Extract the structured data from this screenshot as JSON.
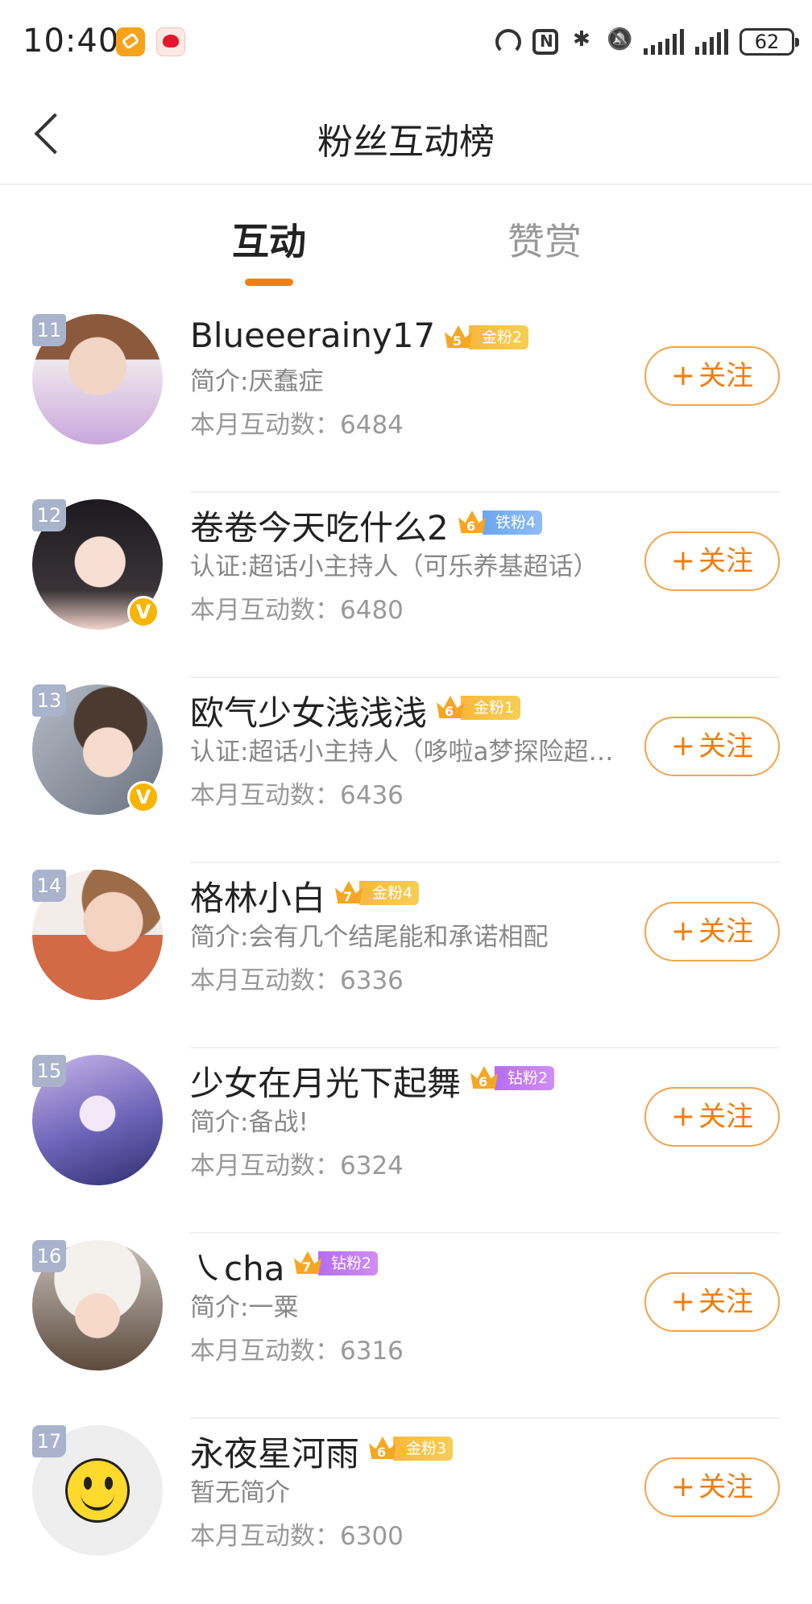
{
  "status_bar": {
    "time": "10:40",
    "battery": "62"
  },
  "header": {
    "title": "粉丝互动榜"
  },
  "tabs": [
    {
      "label": "互动",
      "active": true
    },
    {
      "label": "赞赏",
      "active": false
    }
  ],
  "follow_label": "关注",
  "count_prefix": "本月互动数：",
  "fans": [
    {
      "rank": "11",
      "name": "Blueeerainy17",
      "crown_level": "5",
      "fan_badge": "金粉2",
      "badge_type": "gold",
      "verified": false,
      "desc": "简介:厌蠢症",
      "count": "6484"
    },
    {
      "rank": "12",
      "name": "卷卷今天吃什么2",
      "crown_level": "6",
      "fan_badge": "铁粉4",
      "badge_type": "iron",
      "verified": true,
      "desc": "认证:超话小主持人（可乐养基超话）",
      "count": "6480"
    },
    {
      "rank": "13",
      "name": "欧气少女浅浅浅",
      "crown_level": "6",
      "fan_badge": "金粉1",
      "badge_type": "gold",
      "verified": true,
      "desc": "认证:超话小主持人（哆啦a梦探险超话）",
      "count": "6436"
    },
    {
      "rank": "14",
      "name": "格林小白",
      "crown_level": "7",
      "fan_badge": "金粉4",
      "badge_type": "gold",
      "verified": false,
      "desc": "简介:会有几个结尾能和承诺相配",
      "count": "6336"
    },
    {
      "rank": "15",
      "name": "少女在月光下起舞",
      "crown_level": "6",
      "fan_badge": "钻粉2",
      "badge_type": "diamond",
      "verified": false,
      "desc": "简介:备战!",
      "count": "6324"
    },
    {
      "rank": "16",
      "name": "㇏cha",
      "crown_level": "7",
      "fan_badge": "钻粉2",
      "badge_type": "diamond",
      "verified": false,
      "desc": "简介:一粟",
      "count": "6316"
    },
    {
      "rank": "17",
      "name": "永夜星河雨",
      "crown_level": "6",
      "fan_badge": "金粉3",
      "badge_type": "gold",
      "verified": false,
      "desc": "暂无简介",
      "count": "6300"
    }
  ]
}
